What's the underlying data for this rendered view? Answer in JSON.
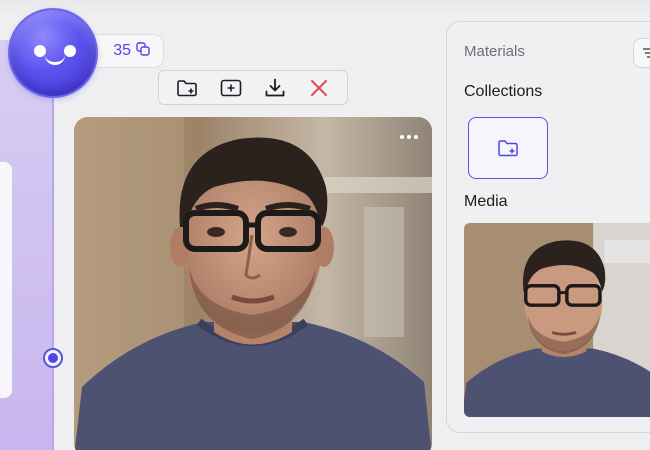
{
  "credits": {
    "count": "35"
  },
  "toolbar": {
    "actions": [
      "new-folder",
      "add",
      "download",
      "delete"
    ]
  },
  "materials": {
    "title": "Materials",
    "collections_label": "Collections",
    "media_label": "Media"
  },
  "colors": {
    "accent": "#4f46e5",
    "delete": "#e5484d",
    "panel_lavender": "#c7b6ee"
  }
}
